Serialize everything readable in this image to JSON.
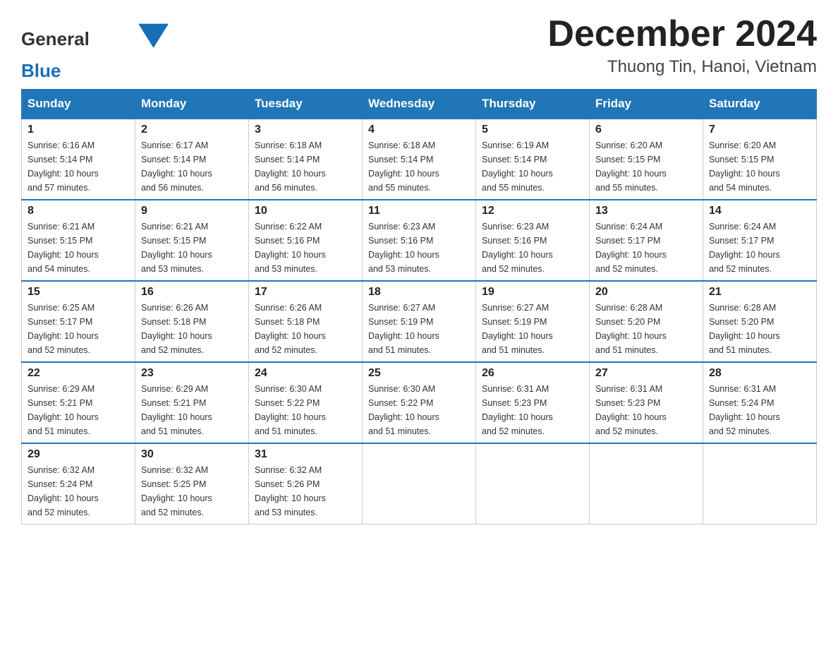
{
  "logo": {
    "general": "General",
    "blue": "Blue"
  },
  "title": "December 2024",
  "subtitle": "Thuong Tin, Hanoi, Vietnam",
  "headers": [
    "Sunday",
    "Monday",
    "Tuesday",
    "Wednesday",
    "Thursday",
    "Friday",
    "Saturday"
  ],
  "weeks": [
    [
      {
        "day": "1",
        "sunrise": "6:16 AM",
        "sunset": "5:14 PM",
        "daylight": "10 hours and 57 minutes."
      },
      {
        "day": "2",
        "sunrise": "6:17 AM",
        "sunset": "5:14 PM",
        "daylight": "10 hours and 56 minutes."
      },
      {
        "day": "3",
        "sunrise": "6:18 AM",
        "sunset": "5:14 PM",
        "daylight": "10 hours and 56 minutes."
      },
      {
        "day": "4",
        "sunrise": "6:18 AM",
        "sunset": "5:14 PM",
        "daylight": "10 hours and 55 minutes."
      },
      {
        "day": "5",
        "sunrise": "6:19 AM",
        "sunset": "5:14 PM",
        "daylight": "10 hours and 55 minutes."
      },
      {
        "day": "6",
        "sunrise": "6:20 AM",
        "sunset": "5:15 PM",
        "daylight": "10 hours and 55 minutes."
      },
      {
        "day": "7",
        "sunrise": "6:20 AM",
        "sunset": "5:15 PM",
        "daylight": "10 hours and 54 minutes."
      }
    ],
    [
      {
        "day": "8",
        "sunrise": "6:21 AM",
        "sunset": "5:15 PM",
        "daylight": "10 hours and 54 minutes."
      },
      {
        "day": "9",
        "sunrise": "6:21 AM",
        "sunset": "5:15 PM",
        "daylight": "10 hours and 53 minutes."
      },
      {
        "day": "10",
        "sunrise": "6:22 AM",
        "sunset": "5:16 PM",
        "daylight": "10 hours and 53 minutes."
      },
      {
        "day": "11",
        "sunrise": "6:23 AM",
        "sunset": "5:16 PM",
        "daylight": "10 hours and 53 minutes."
      },
      {
        "day": "12",
        "sunrise": "6:23 AM",
        "sunset": "5:16 PM",
        "daylight": "10 hours and 52 minutes."
      },
      {
        "day": "13",
        "sunrise": "6:24 AM",
        "sunset": "5:17 PM",
        "daylight": "10 hours and 52 minutes."
      },
      {
        "day": "14",
        "sunrise": "6:24 AM",
        "sunset": "5:17 PM",
        "daylight": "10 hours and 52 minutes."
      }
    ],
    [
      {
        "day": "15",
        "sunrise": "6:25 AM",
        "sunset": "5:17 PM",
        "daylight": "10 hours and 52 minutes."
      },
      {
        "day": "16",
        "sunrise": "6:26 AM",
        "sunset": "5:18 PM",
        "daylight": "10 hours and 52 minutes."
      },
      {
        "day": "17",
        "sunrise": "6:26 AM",
        "sunset": "5:18 PM",
        "daylight": "10 hours and 52 minutes."
      },
      {
        "day": "18",
        "sunrise": "6:27 AM",
        "sunset": "5:19 PM",
        "daylight": "10 hours and 51 minutes."
      },
      {
        "day": "19",
        "sunrise": "6:27 AM",
        "sunset": "5:19 PM",
        "daylight": "10 hours and 51 minutes."
      },
      {
        "day": "20",
        "sunrise": "6:28 AM",
        "sunset": "5:20 PM",
        "daylight": "10 hours and 51 minutes."
      },
      {
        "day": "21",
        "sunrise": "6:28 AM",
        "sunset": "5:20 PM",
        "daylight": "10 hours and 51 minutes."
      }
    ],
    [
      {
        "day": "22",
        "sunrise": "6:29 AM",
        "sunset": "5:21 PM",
        "daylight": "10 hours and 51 minutes."
      },
      {
        "day": "23",
        "sunrise": "6:29 AM",
        "sunset": "5:21 PM",
        "daylight": "10 hours and 51 minutes."
      },
      {
        "day": "24",
        "sunrise": "6:30 AM",
        "sunset": "5:22 PM",
        "daylight": "10 hours and 51 minutes."
      },
      {
        "day": "25",
        "sunrise": "6:30 AM",
        "sunset": "5:22 PM",
        "daylight": "10 hours and 51 minutes."
      },
      {
        "day": "26",
        "sunrise": "6:31 AM",
        "sunset": "5:23 PM",
        "daylight": "10 hours and 52 minutes."
      },
      {
        "day": "27",
        "sunrise": "6:31 AM",
        "sunset": "5:23 PM",
        "daylight": "10 hours and 52 minutes."
      },
      {
        "day": "28",
        "sunrise": "6:31 AM",
        "sunset": "5:24 PM",
        "daylight": "10 hours and 52 minutes."
      }
    ],
    [
      {
        "day": "29",
        "sunrise": "6:32 AM",
        "sunset": "5:24 PM",
        "daylight": "10 hours and 52 minutes."
      },
      {
        "day": "30",
        "sunrise": "6:32 AM",
        "sunset": "5:25 PM",
        "daylight": "10 hours and 52 minutes."
      },
      {
        "day": "31",
        "sunrise": "6:32 AM",
        "sunset": "5:26 PM",
        "daylight": "10 hours and 53 minutes."
      },
      null,
      null,
      null,
      null
    ]
  ],
  "labels": {
    "sunrise": "Sunrise:",
    "sunset": "Sunset:",
    "daylight": "Daylight:"
  }
}
